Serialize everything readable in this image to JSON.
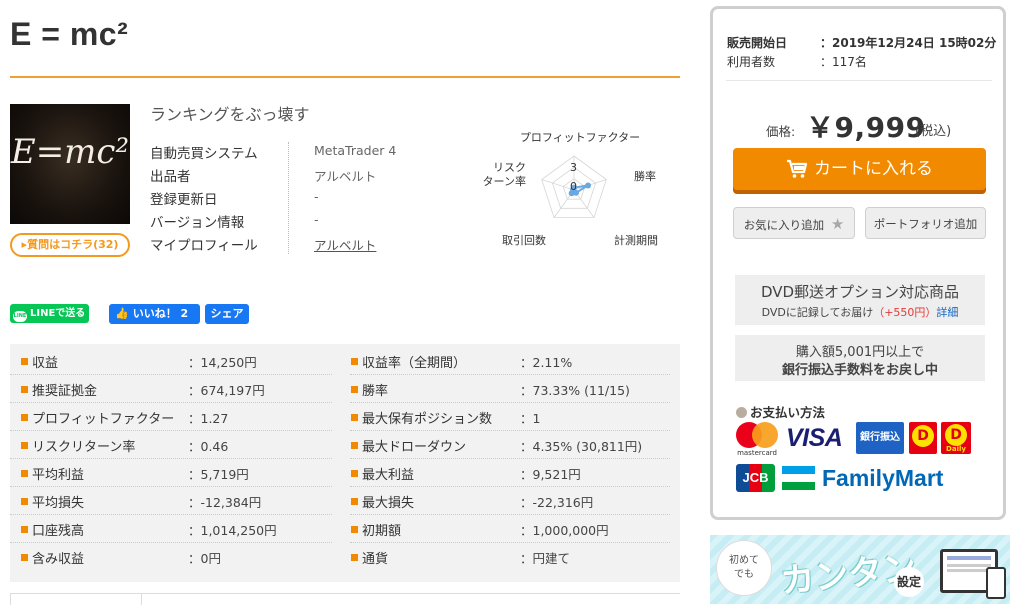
{
  "product": {
    "title": "E = mc²",
    "thumb_text": "E=mc²",
    "question_button": "質問はコチラ(32)",
    "tagline": "ランキングをぶっ壊す",
    "info": [
      {
        "label": "自動売買システム",
        "value": "MetaTrader 4"
      },
      {
        "label": "出品者",
        "value": "アルベルト"
      },
      {
        "label": "登録更新日",
        "value": "-"
      },
      {
        "label": "バージョン情報",
        "value": "-"
      },
      {
        "label": "マイプロフィール",
        "value": "アルベルト"
      }
    ]
  },
  "radar": {
    "labels": {
      "profit_factor": "プロフィットファクター",
      "win_rate": "勝率",
      "period": "計測期間",
      "trades": "取引回数",
      "risk_return": "リスク\nターン率",
      "risk_line1": "リスク",
      "risk_line2": "ターン率"
    },
    "scale_max": "3",
    "scale_min": "0",
    "values": {
      "profit_factor": 0.2,
      "win_rate": 1.3,
      "period": 0.3,
      "trades": 0.35,
      "risk_return": 0.1
    },
    "scale": 3,
    "color": "#6aa9e0"
  },
  "social": {
    "line": "LINEで送る",
    "like": "いいね！ 2",
    "share": "シェア"
  },
  "stats": [
    {
      "l_label": "収益",
      "l_value": "：14,250円",
      "r_label": "収益率（全期間）",
      "r_value": "：2.11%"
    },
    {
      "l_label": "推奨証拠金",
      "l_value": "：674,197円",
      "r_label": "勝率",
      "r_value": "：73.33% (11/15)"
    },
    {
      "l_label": "プロフィットファクター",
      "l_value": "：1.27",
      "r_label": "最大保有ポジション数",
      "r_value": "：1"
    },
    {
      "l_label": "リスクリターン率",
      "l_value": "：0.46",
      "r_label": "最大ドローダウン",
      "r_value": "：4.35% (30,811円)"
    },
    {
      "l_label": "平均利益",
      "l_value": "：5,719円",
      "r_label": "最大利益",
      "r_value": "：9,521円"
    },
    {
      "l_label": "平均損失",
      "l_value": "：-12,384円",
      "r_label": "最大損失",
      "r_value": "：-22,316円"
    },
    {
      "l_label": "口座残高",
      "l_value": "：1,014,250円",
      "r_label": "初期額",
      "r_value": "：1,000,000円"
    },
    {
      "l_label": "含み収益",
      "l_value": "：0円",
      "r_label": "通貨",
      "r_value": "：円建て"
    }
  ],
  "sidebar": {
    "sale_start_label": "販売開始日",
    "sale_start_value": "：2019年12月24日 15時02分",
    "users_label": "利用者数",
    "users_value": "：117名",
    "price_label": "価格:",
    "price": "￥9,999",
    "price_tax": "(税込)",
    "cart_button": "カートに入れる",
    "favorite_button": "お気に入り追加",
    "portfolio_button": "ポートフォリオ追加",
    "dvd_title": "DVD郵送オプション対応商品",
    "dvd_sub": "DVDに記録してお届け",
    "dvd_price": "（+550円）",
    "dvd_link": "詳細",
    "bank_line1": "購入額5,001円以上で",
    "bank_line2": "銀行振込手数料をお戻し中",
    "payment_title": "お支払い方法",
    "payments": {
      "mastercard": "mastercard",
      "visa": "VISA",
      "bank": "銀行振込",
      "daily": "Daily",
      "jcb": "JCB",
      "familymart": "FamilyMart"
    }
  },
  "banner": {
    "small_1": "初めて",
    "small_2": "でも",
    "big": "カンタン",
    "setup": "設定"
  },
  "colors": {
    "accent": "#f28a00",
    "title_rule": "#f0a030",
    "line_green": "#06c755",
    "facebook_blue": "#1877f2"
  }
}
